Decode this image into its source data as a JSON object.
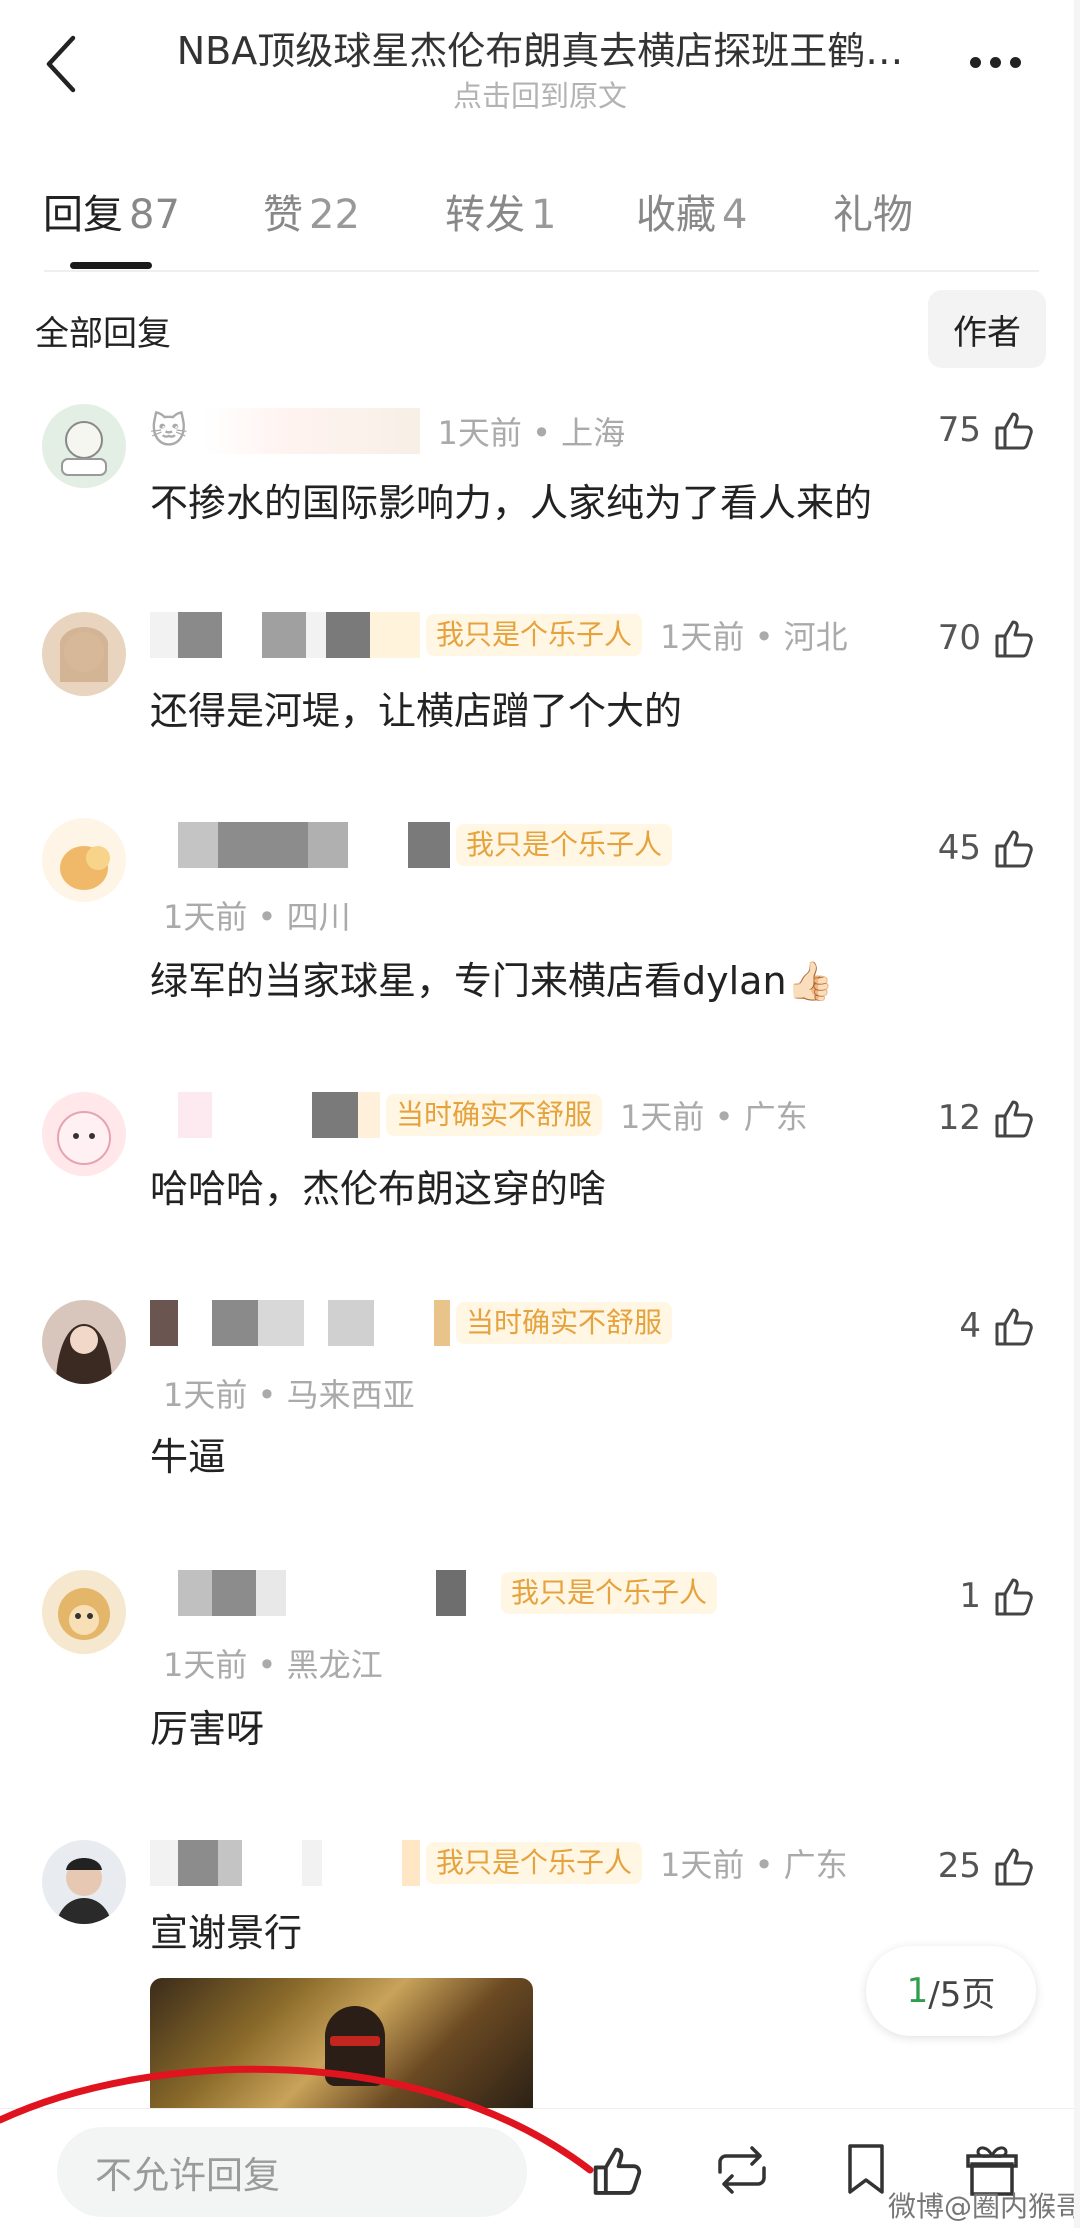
{
  "header": {
    "title": "NBA顶级球星杰伦布朗真去横店探班王鹤…",
    "subtitle": "点击回到原文"
  },
  "tabs": [
    {
      "label": "回复",
      "count": "87"
    },
    {
      "label": "赞",
      "count": "22"
    },
    {
      "label": "转发",
      "count": "1"
    },
    {
      "label": "收藏",
      "count": "4"
    },
    {
      "label": "礼物",
      "count": ""
    }
  ],
  "filter": {
    "label": "全部回复",
    "author_button": "作者"
  },
  "comments": [
    {
      "badge": "",
      "time": "1天前",
      "location": "上海",
      "likes": "75",
      "content": "不掺水的国际影响力，人家纯为了看人来的"
    },
    {
      "badge": "我只是个乐子人",
      "time": "1天前",
      "location": "河北",
      "likes": "70",
      "content": "还得是河堤，让横店蹭了个大的"
    },
    {
      "badge": "我只是个乐子人",
      "time": "1天前",
      "location": "四川",
      "likes": "45",
      "content": "绿军的当家球星，专门来横店看dylan👍🏻"
    },
    {
      "badge": "当时确实不舒服",
      "time": "1天前",
      "location": "广东",
      "likes": "12",
      "content": "哈哈哈，杰伦布朗这穿的啥"
    },
    {
      "badge": "当时确实不舒服",
      "time": "1天前",
      "location": "马来西亚",
      "likes": "4",
      "content": "牛逼"
    },
    {
      "badge": "我只是个乐子人",
      "time": "1天前",
      "location": "黑龙江",
      "likes": "1",
      "content": "厉害呀"
    },
    {
      "badge": "我只是个乐子人",
      "time": "1天前",
      "location": "广东",
      "likes": "25",
      "content": "宣谢景行"
    }
  ],
  "pagination": {
    "current": "1",
    "total_text": "/5页"
  },
  "bottom_bar": {
    "reply_placeholder": "不允许回复"
  },
  "watermark": "微博@圈内猴哥",
  "colors": {
    "badge_text": "#e6a23c",
    "badge_bg": "#fff6e3",
    "accent_green": "#2e9e4f",
    "annotation_red": "#e0141e"
  }
}
